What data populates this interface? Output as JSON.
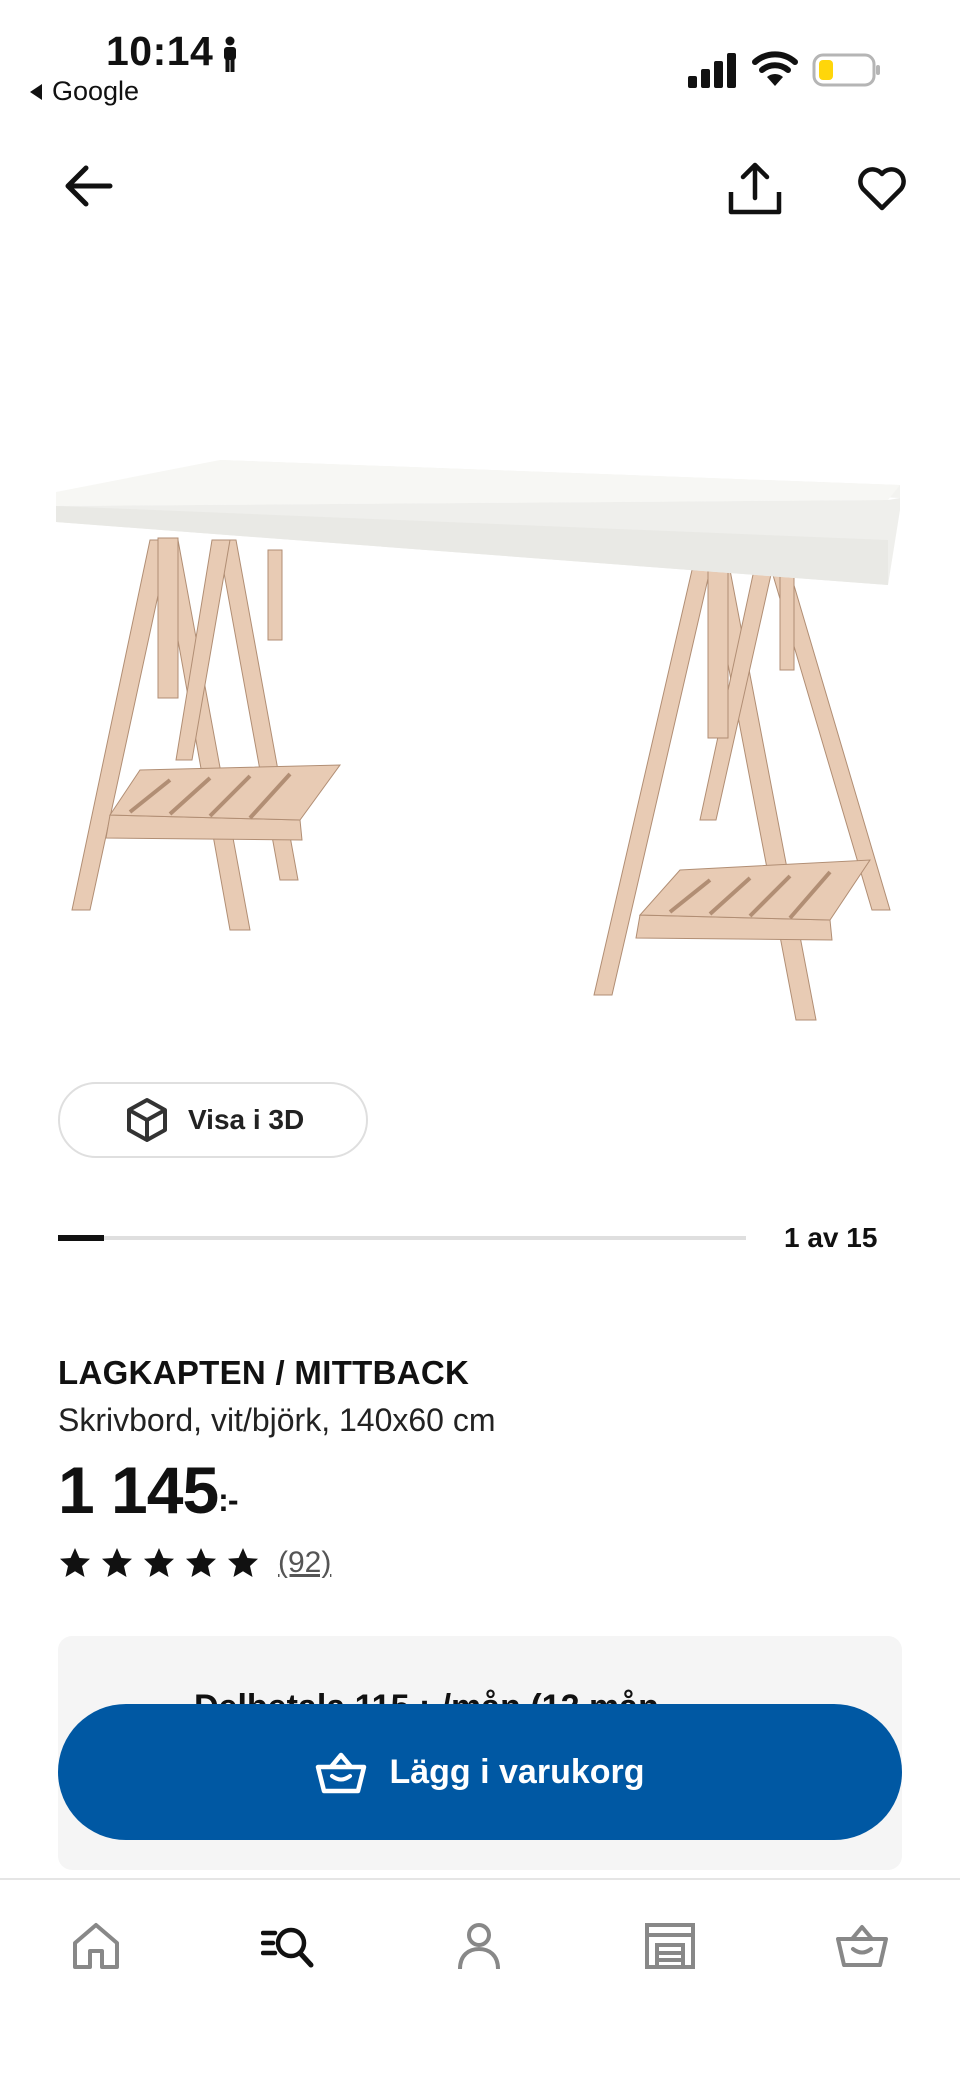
{
  "status_bar": {
    "time": "10:14",
    "back_app": "Google"
  },
  "icons": {
    "back": "arrow-left-icon",
    "share": "share-icon",
    "favourite": "heart-icon",
    "cube": "cube-3d-icon",
    "basket": "basket-icon"
  },
  "view_3d": {
    "label": "Visa i 3D"
  },
  "carousel": {
    "pager": "1 av 15",
    "current": 1,
    "total": 15
  },
  "product": {
    "name": "LAGKAPTEN / MITTBACK",
    "description": "Skrivbord, vit/björk, 140x60 cm",
    "price": "1 145",
    "price_suffix": ":-",
    "rating": 5,
    "reviews": "(92)"
  },
  "info_card": {
    "peek_text": "Delbetala 115 :-/mån (12 mån"
  },
  "add_to_cart": {
    "label": "Lägg i varukorg"
  },
  "tabbar": {
    "items": [
      "home-icon",
      "search-icon",
      "profile-icon",
      "store-icon",
      "cart-icon"
    ],
    "active": "search-icon"
  },
  "colors": {
    "accent": "#0058a3",
    "battery": "#ffd60a"
  }
}
